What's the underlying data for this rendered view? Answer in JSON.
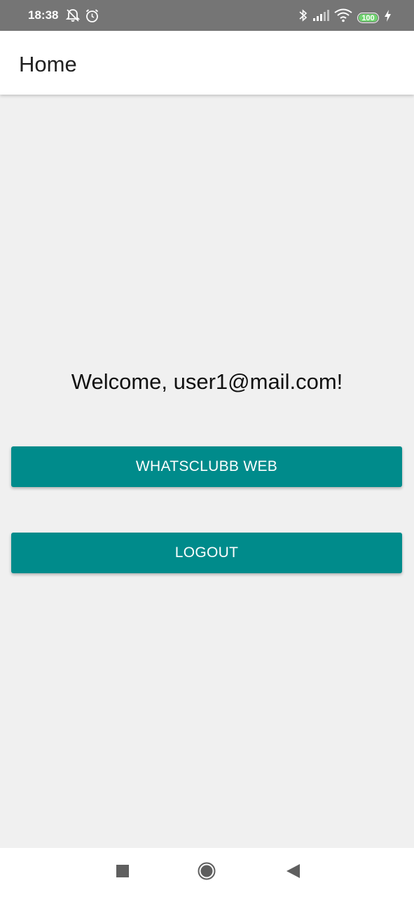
{
  "status_bar": {
    "time": "18:38",
    "battery": "100",
    "icons": [
      "alarm-off-icon",
      "alarm-clock-icon",
      "bluetooth-icon",
      "cellular-signal-icon",
      "wifi-icon",
      "battery-icon",
      "charging-bolt-icon"
    ],
    "battery_color": "#6fd36f"
  },
  "app_bar": {
    "title": "Home"
  },
  "main": {
    "welcome_text": "Welcome, user1@mail.com!",
    "web_button_label": "WHATSCLUBB WEB",
    "logout_button_label": "LOGOUT",
    "accent_color": "#008b8b"
  },
  "nav_bar": {
    "icons": [
      "recent-apps-icon",
      "home-icon",
      "back-icon"
    ]
  }
}
